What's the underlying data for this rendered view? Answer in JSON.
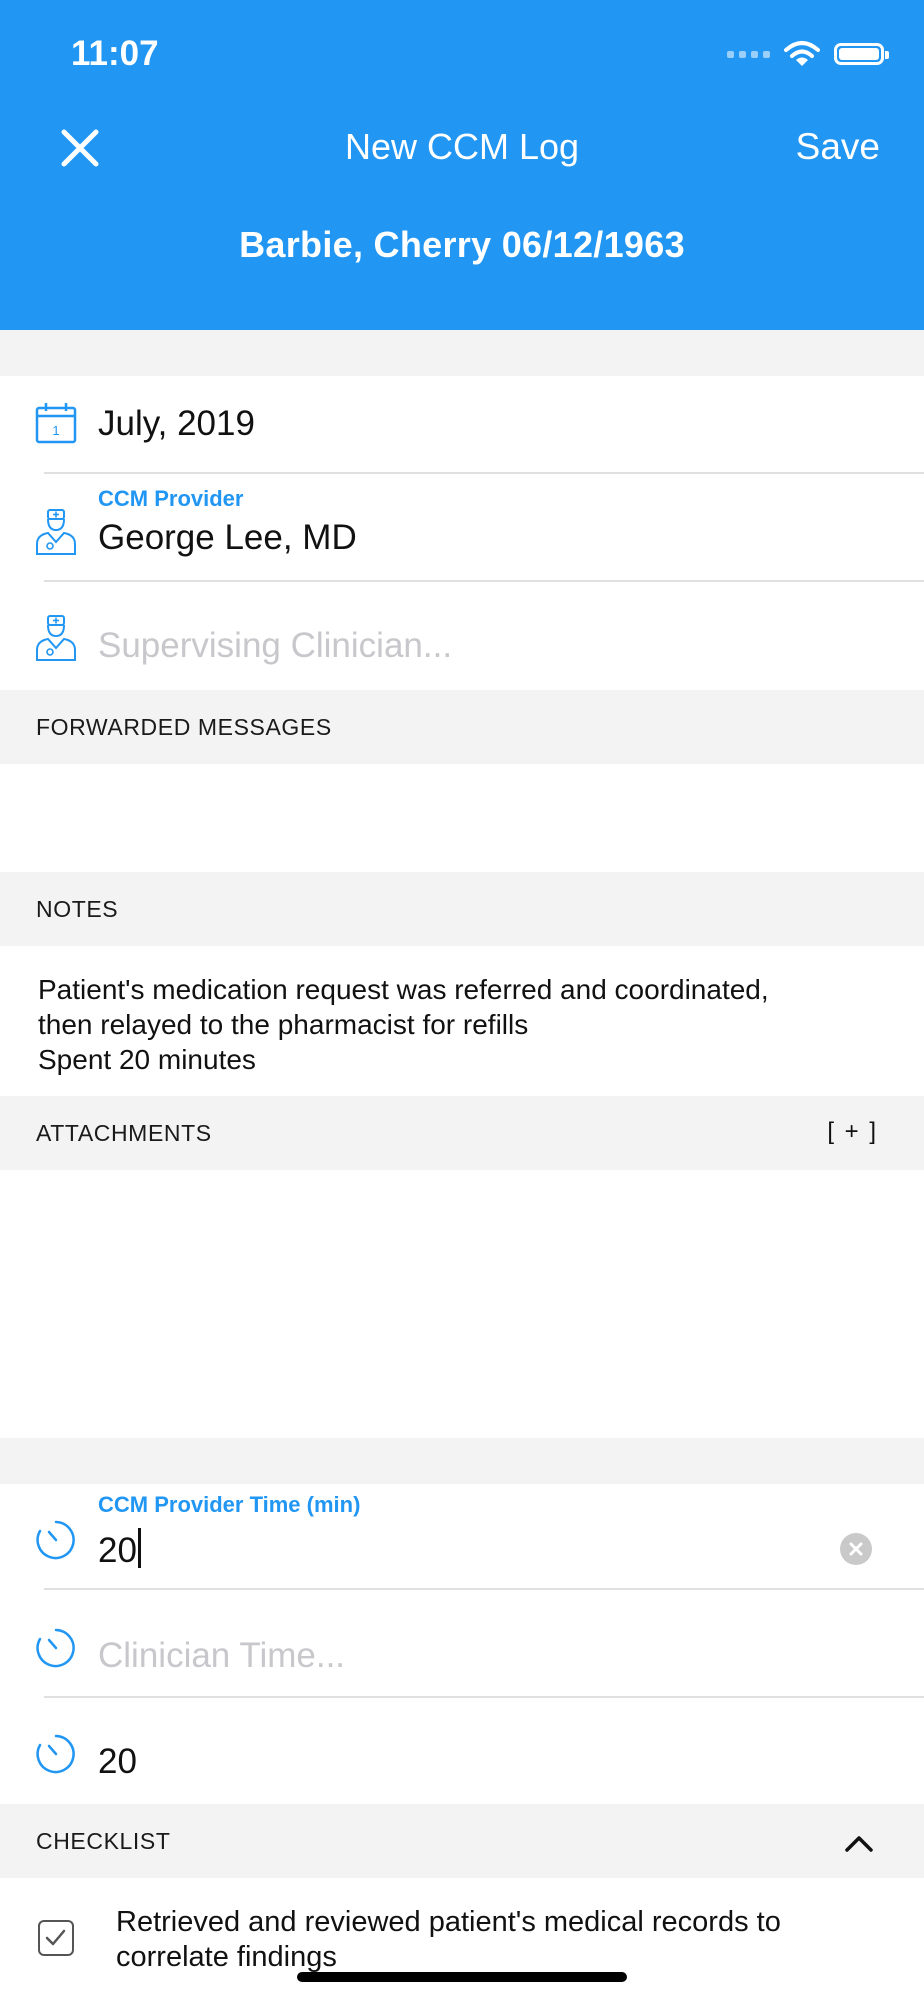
{
  "status_bar": {
    "time": "11:07"
  },
  "nav": {
    "title": "New CCM Log",
    "save_label": "Save",
    "close_icon": "close-icon"
  },
  "patient": {
    "label": "Barbie, Cherry 06/12/1963"
  },
  "colors": {
    "primary": "#2196f3",
    "section_bg": "#f3f3f3",
    "placeholder": "#c7c7cc"
  },
  "form": {
    "date": {
      "icon": "calendar-icon",
      "value": "July, 2019"
    },
    "provider": {
      "icon": "doctor-icon",
      "label": "CCM Provider",
      "value": "George Lee, MD"
    },
    "supervising": {
      "icon": "doctor-icon",
      "placeholder": "Supervising Clinician..."
    }
  },
  "sections": {
    "forwarded_messages": "FORWARDED MESSAGES",
    "notes": "NOTES",
    "attachments": "ATTACHMENTS",
    "attachments_add": "[ + ]",
    "checklist": "CHECKLIST"
  },
  "notes": {
    "line1": "Patient's medication request was referred and coordinated,",
    "line2": "then relayed to the pharmacist for refills",
    "line3": "Spent 20 minutes"
  },
  "time": {
    "provider_time": {
      "icon": "timer-icon",
      "label": "CCM Provider Time (min)",
      "value": "20"
    },
    "clinician_time": {
      "icon": "timer-icon",
      "placeholder": "Clinician Time..."
    },
    "total": {
      "icon": "timer-icon",
      "value": "20"
    }
  },
  "checklist": {
    "items": [
      {
        "checked": true,
        "text": "Retrieved and reviewed patient's medical records to correlate findings"
      }
    ]
  }
}
